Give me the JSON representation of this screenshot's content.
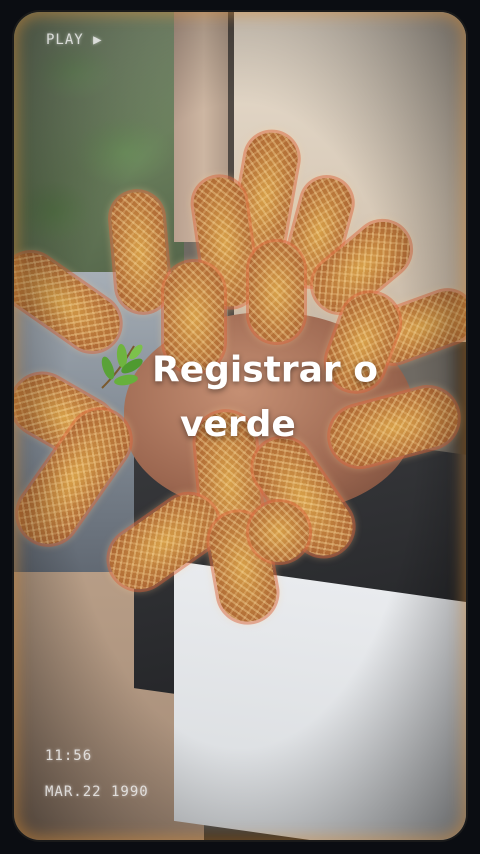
{
  "overlay": {
    "play_label": "PLAY ▶",
    "time": "11:56",
    "date": "MAR.22 1990"
  },
  "title": {
    "line1": "Registrar o",
    "line2": "verde",
    "icon": "leaf-branch-icon"
  },
  "colors": {
    "title_text": "#ffffff",
    "leaf_green": "#6fb43f",
    "frame_glow": "#e6963c"
  }
}
